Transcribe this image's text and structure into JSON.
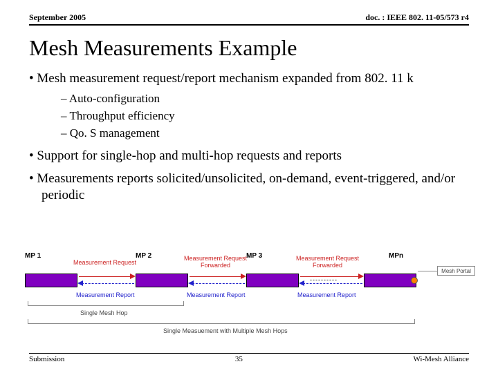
{
  "header": {
    "date": "September 2005",
    "doc": "doc. : IEEE 802. 11-05/573 r4"
  },
  "title": "Mesh Measurements Example",
  "bullets": {
    "b1": "Mesh measurement request/report mechanism expanded from 802. 11 k",
    "s1": "Auto-configuration",
    "s2": "Throughput efficiency",
    "s3": "Qo. S management",
    "b2": "Support for single-hop and multi-hop requests and reports",
    "b3": "Measurements reports solicited/unsolicited, on-demand, event-triggered, and/or periodic"
  },
  "diagram": {
    "mp1": "MP 1",
    "mp2": "MP 2",
    "mp3": "MP 3",
    "mpn": "MPn",
    "dots": "----------",
    "req": "Measurement Request",
    "reqFwd": "Measurement Request\nForwarded",
    "rep": "Measurement Report",
    "singleHop": "Single Mesh Hop",
    "multiHop": "Single Measuement with Multiple Mesh Hops",
    "portal": "Mesh Portal"
  },
  "footer": {
    "left": "Submission",
    "center": "35",
    "right": "Wi-Mesh Alliance"
  }
}
